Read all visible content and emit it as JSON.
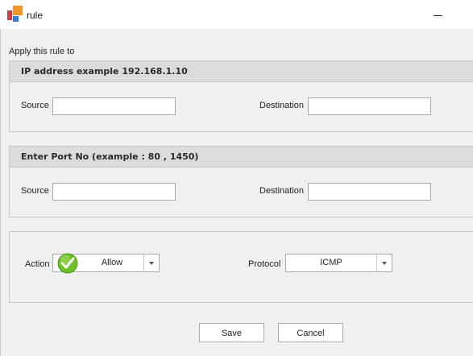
{
  "window": {
    "title": "rule"
  },
  "apply_label": "Apply this rule to",
  "ip_group": {
    "title": "IP address example 192.168.1.10",
    "source_label": "Source",
    "source_value": "",
    "destination_label": "Destination",
    "destination_value": ""
  },
  "port_group": {
    "title": "Enter Port No (example :  80 , 1450)",
    "source_label": "Source",
    "source_value": "",
    "destination_label": "Destination",
    "destination_value": ""
  },
  "action_group": {
    "action_label": "Action",
    "action_value": "Allow",
    "protocol_label": "Protocol",
    "protocol_value": "ICMP"
  },
  "buttons": {
    "save": "Save",
    "cancel": "Cancel"
  },
  "icons": {
    "app": "app-logo-icon",
    "minimize": "minimize-icon",
    "check": "green-check-icon",
    "dropdown": "chevron-down-icon"
  },
  "colors": {
    "header_bg": "#dcdcdc",
    "window_bg": "#f0f0f0",
    "check_green": "#6fbf2a",
    "logo_orange": "#f0962a",
    "logo_red": "#d73a3a",
    "logo_blue": "#3a7bd5"
  }
}
